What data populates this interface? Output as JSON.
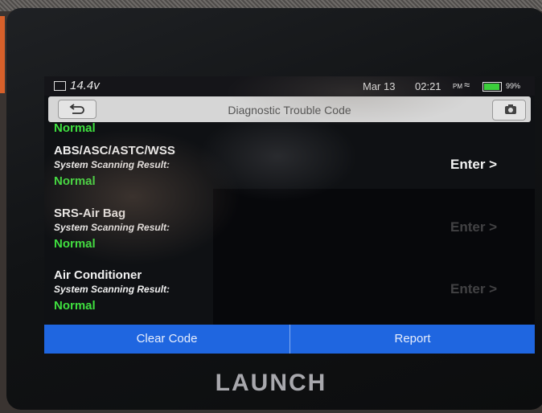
{
  "status_bar": {
    "voltage": "14.4v",
    "date": "Mar 13",
    "time": "02:21",
    "ampm": "PM",
    "battery_percent": "99%"
  },
  "title_bar": {
    "title": "Diagnostic Trouble Code"
  },
  "list": {
    "top_partial_result": "Normal",
    "systems": [
      {
        "name": "ABS/ASC/ASTC/WSS",
        "scan_label": "System Scanning Result:",
        "result": "Normal",
        "enter_label": "Enter >"
      },
      {
        "name": "SRS-Air Bag",
        "scan_label": "System Scanning Result:",
        "result": "Normal",
        "enter_label": "Enter >"
      },
      {
        "name": "Air Conditioner",
        "scan_label": "System Scanning Result:",
        "result": "Normal",
        "enter_label": "Enter >"
      }
    ]
  },
  "bottom_bar": {
    "clear_code_label": "Clear Code",
    "report_label": "Report"
  },
  "brand": "LAUNCH",
  "colors": {
    "accent_blue": "#1f66e0",
    "ok_green": "#3fe03f",
    "title_bar_bg": "#d6d6d6"
  }
}
